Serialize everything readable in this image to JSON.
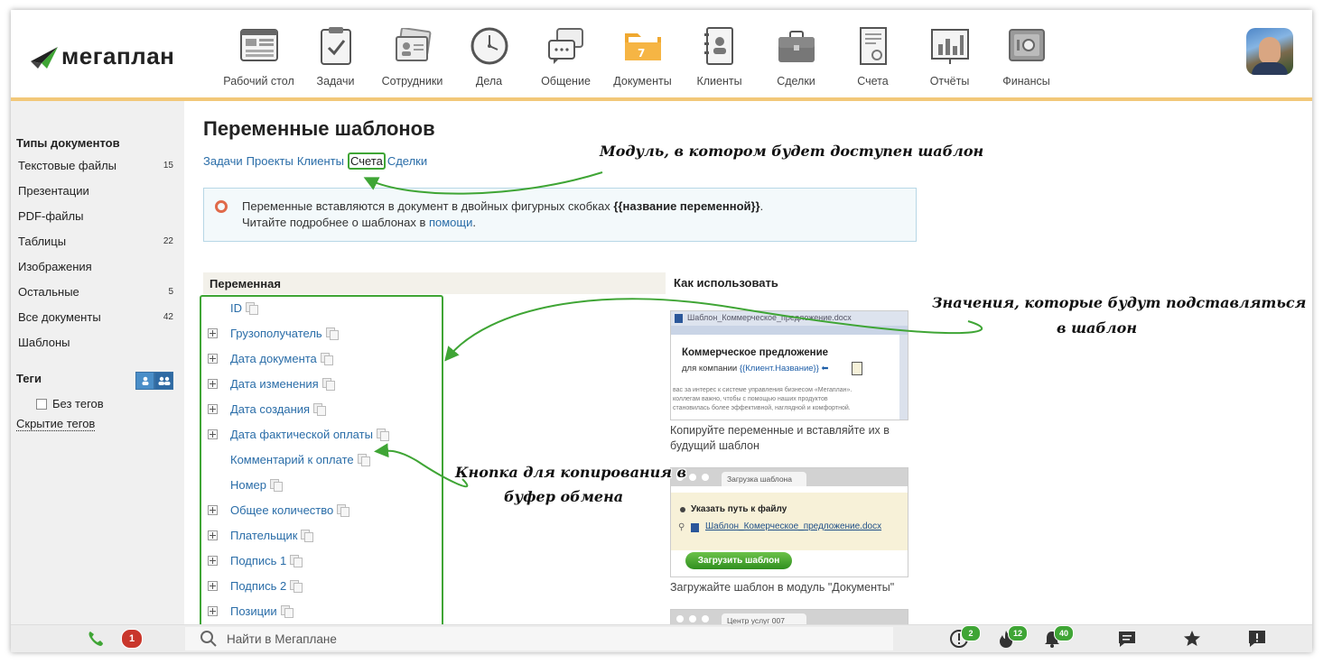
{
  "header": {
    "logo": "мегаплан",
    "nav": [
      {
        "label": "Рабочий стол",
        "icon": "desktop-icon"
      },
      {
        "label": "Задачи",
        "icon": "tasks-clipboard-icon"
      },
      {
        "label": "Сотрудники",
        "icon": "employees-icon"
      },
      {
        "label": "Дела",
        "icon": "clock-icon"
      },
      {
        "label": "Общение",
        "icon": "chat-bubbles-icon"
      },
      {
        "label": "Документы",
        "icon": "folder-icon",
        "active": true
      },
      {
        "label": "Клиенты",
        "icon": "contacts-book-icon"
      },
      {
        "label": "Сделки",
        "icon": "briefcase-icon"
      },
      {
        "label": "Счета",
        "icon": "invoice-icon"
      },
      {
        "label": "Отчёты",
        "icon": "bar-chart-icon"
      },
      {
        "label": "Финансы",
        "icon": "safe-icon"
      }
    ]
  },
  "sidebar": {
    "doc_types_title": "Типы документов",
    "items": [
      {
        "label": "Текстовые файлы",
        "count": "15"
      },
      {
        "label": "Презентации",
        "count": ""
      },
      {
        "label": "PDF-файлы",
        "count": ""
      },
      {
        "label": "Таблицы",
        "count": "22"
      },
      {
        "label": "Изображения",
        "count": ""
      },
      {
        "label": "Остальные",
        "count": "5"
      },
      {
        "label": "Все документы",
        "count": "42"
      },
      {
        "label": "Шаблоны",
        "count": ""
      }
    ],
    "tags_title": "Теги",
    "no_tags": "Без тегов",
    "hide_tags": "Скрытие тегов"
  },
  "main": {
    "title": "Переменные шаблонов",
    "modules": [
      {
        "label": "Задачи",
        "selected": false
      },
      {
        "label": "Проекты",
        "selected": false
      },
      {
        "label": "Клиенты",
        "selected": false
      },
      {
        "label": "Счета",
        "selected": true
      },
      {
        "label": "Сделки",
        "selected": false
      }
    ],
    "info_line1_prefix": "Переменные вставляются в документ в двойных фигурных скобках ",
    "info_line1_bold": "{{название переменной}}",
    "info_line1_suffix": ".",
    "info_line2_prefix": "Читайте подробнее о шаблонах в ",
    "info_line2_link": "помощи",
    "info_line2_suffix": ".",
    "col_variable": "Переменная",
    "col_usage": "Как использовать",
    "variables": [
      {
        "name": "ID",
        "expandable": false
      },
      {
        "name": "Грузополучатель",
        "expandable": true
      },
      {
        "name": "Дата документа",
        "expandable": true
      },
      {
        "name": "Дата изменения",
        "expandable": true
      },
      {
        "name": "Дата создания",
        "expandable": true
      },
      {
        "name": "Дата фактической оплаты",
        "expandable": true
      },
      {
        "name": "Комментарий к оплате",
        "expandable": false
      },
      {
        "name": "Номер",
        "expandable": false
      },
      {
        "name": "Общее количество",
        "expandable": true
      },
      {
        "name": "Плательщик",
        "expandable": true
      },
      {
        "name": "Подпись 1",
        "expandable": true
      },
      {
        "name": "Подпись 2",
        "expandable": true
      },
      {
        "name": "Позиции",
        "expandable": true
      }
    ],
    "usage": {
      "thumb1_file": "Шаблон_Коммерческое_предложение.docx",
      "thumb1_heading": "Коммерческое предложение",
      "thumb1_for": "для компании",
      "thumb1_var": "{{Клиент.Название}}",
      "thumb1_text1": "вас за интерес к системе управления бизнесом «Мегаплан».",
      "thumb1_text2": "коллегам важно, чтобы с помощью наших продуктов",
      "thumb1_text3": "становилась более эффективной, наглядной и комфортной.",
      "caption1": "Копируйте переменные и вставляйте их в будущий шаблон",
      "thumb2_tab": "Загрузка шаблона",
      "thumb2_radio": "Указать путь к файлу",
      "thumb2_file": "Шаблон_Комерческое_предложение.docx",
      "thumb2_button": "Загрузить шаблон",
      "caption2": "Загружайте шаблон в модуль \"Документы\"",
      "thumb3_tab": "Центр услуг 007"
    }
  },
  "annotations": {
    "module": "Модуль, в котором будет доступен шаблон",
    "values_line1": "Значения, которые будут подставляться",
    "values_line2": "в шаблон",
    "copy_line1": "Кнопка для копирования в",
    "copy_line2": "буфер обмена"
  },
  "bottombar": {
    "missed_calls": "1",
    "search_placeholder": "Найти в Мегаплане",
    "alerts_count": "2",
    "hot_count": "12",
    "notifications_count": "40"
  }
}
